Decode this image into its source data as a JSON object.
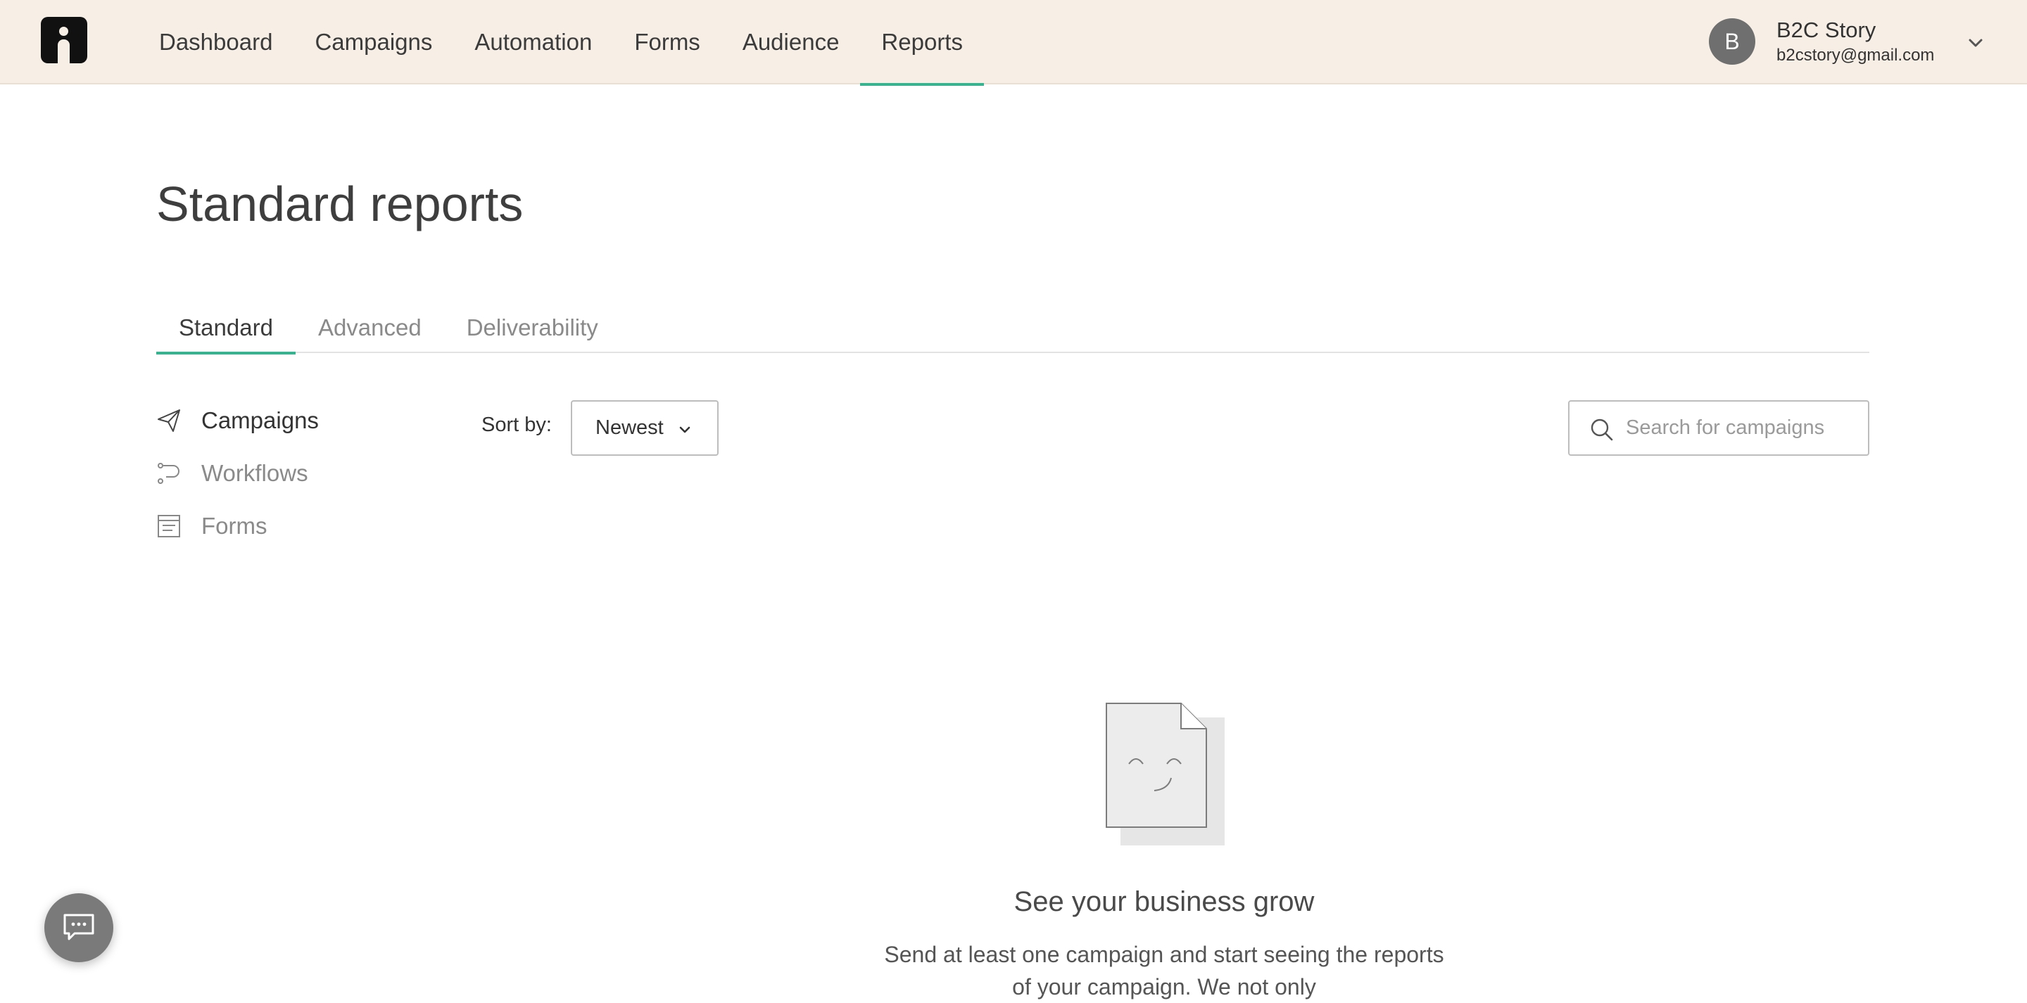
{
  "nav": {
    "items": [
      {
        "label": "Dashboard"
      },
      {
        "label": "Campaigns"
      },
      {
        "label": "Automation"
      },
      {
        "label": "Forms"
      },
      {
        "label": "Audience"
      },
      {
        "label": "Reports"
      }
    ],
    "active": "Reports",
    "accent_color": "#35b48f",
    "background_color": "#f7efe5"
  },
  "user": {
    "avatar_initial": "B",
    "name": "B2C Story",
    "email": "b2cstory@gmail.com"
  },
  "page": {
    "title": "Standard reports"
  },
  "tabs": [
    {
      "label": "Standard"
    },
    {
      "label": "Advanced"
    },
    {
      "label": "Deliverability"
    }
  ],
  "side_menu": [
    {
      "label": "Campaigns",
      "icon": "paper-plane-icon"
    },
    {
      "label": "Workflows",
      "icon": "workflow-icon"
    },
    {
      "label": "Forms",
      "icon": "form-icon"
    }
  ],
  "sort": {
    "label": "Sort by:",
    "selected": "Newest"
  },
  "search": {
    "placeholder": "Search for campaigns"
  },
  "empty_state": {
    "icon": "smiling-document-icon",
    "heading": "See your business grow",
    "text": "Send at least one campaign and start seeing the reports of your campaign. We not only"
  },
  "chat": {
    "icon": "chat-bubble-icon"
  }
}
